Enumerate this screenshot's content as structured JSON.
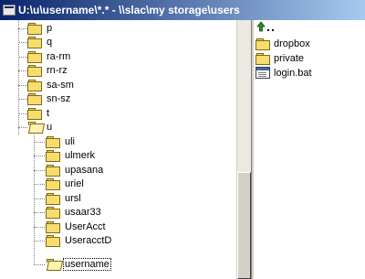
{
  "window": {
    "title": "U:\\u\\username\\*.* - \\\\slac\\my storage\\users",
    "icon": "drive-window-icon"
  },
  "tree": {
    "top_level": [
      "p",
      "q",
      "ra-rm",
      "rn-rz",
      "sa-sm",
      "sn-sz",
      "t",
      "u"
    ],
    "u_children": [
      "uli",
      "ulmerk",
      "upasana",
      "uriel",
      "ursl",
      "usaar33",
      "UserAcct",
      "UseracctD",
      "username"
    ],
    "selected": "username"
  },
  "file_list": {
    "up_icon": "up-folder-icon",
    "items": [
      {
        "name": "dropbox",
        "icon": "folder-icon"
      },
      {
        "name": "private",
        "icon": "folder-icon"
      },
      {
        "name": "login.bat",
        "icon": "batch-file-icon"
      }
    ]
  },
  "colors": {
    "title_start": "#0a246a",
    "title_end": "#a6caf0",
    "chrome": "#d4d0c8"
  }
}
